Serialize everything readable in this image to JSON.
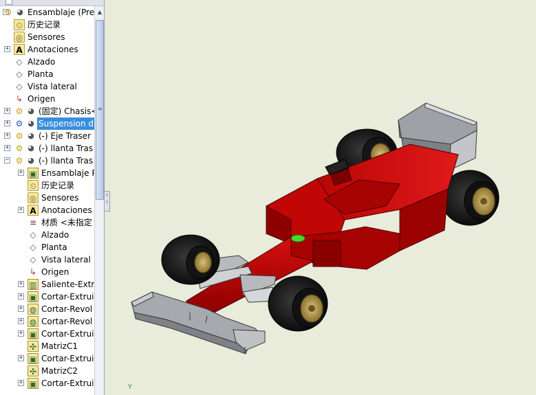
{
  "tree": {
    "rows": [
      {
        "label": "Ensamblaje  (Pre",
        "indent": 0,
        "expander": "−",
        "icon": "assembly-icon",
        "selected": false
      },
      {
        "label": "历史记录",
        "indent": 1,
        "expander": "",
        "icon": "history-icon",
        "selected": false
      },
      {
        "label": "Sensores",
        "indent": 1,
        "expander": "",
        "icon": "sensors-icon",
        "selected": false
      },
      {
        "label": "Anotaciones",
        "indent": 1,
        "expander": "+",
        "icon": "annotations-icon",
        "selected": false
      },
      {
        "label": "Alzado",
        "indent": 1,
        "expander": "",
        "icon": "plane-icon",
        "selected": false
      },
      {
        "label": "Planta",
        "indent": 1,
        "expander": "",
        "icon": "plane-icon",
        "selected": false
      },
      {
        "label": "Vista lateral",
        "indent": 1,
        "expander": "",
        "icon": "plane-icon",
        "selected": false
      },
      {
        "label": "Origen",
        "indent": 1,
        "expander": "",
        "icon": "origin-icon",
        "selected": false
      },
      {
        "label": "(固定) Chasis<",
        "indent": 1,
        "expander": "+",
        "icon": "subassembly-icon",
        "selected": false
      },
      {
        "label": "Suspension d",
        "indent": 1,
        "expander": "+",
        "icon": "subassembly-icon",
        "selected": true
      },
      {
        "label": "(-) Eje Traser",
        "indent": 1,
        "expander": "+",
        "icon": "subassembly-icon",
        "selected": false
      },
      {
        "label": "(-) llanta Tras",
        "indent": 1,
        "expander": "+",
        "icon": "subassembly-icon",
        "selected": false
      },
      {
        "label": "(-) llanta Tras",
        "indent": 1,
        "expander": "−",
        "icon": "subassembly-icon",
        "selected": false
      },
      {
        "label": "Ensamblaje P",
        "indent": 2,
        "expander": "+",
        "icon": "part-doc-icon",
        "selected": false
      },
      {
        "label": "历史记录",
        "indent": 2,
        "expander": "",
        "icon": "history-icon",
        "selected": false
      },
      {
        "label": "Sensores",
        "indent": 2,
        "expander": "",
        "icon": "sensors-icon",
        "selected": false
      },
      {
        "label": "Anotaciones",
        "indent": 2,
        "expander": "+",
        "icon": "annotations-icon",
        "selected": false
      },
      {
        "label": "材质 <未指定",
        "indent": 2,
        "expander": "",
        "icon": "material-icon",
        "selected": false
      },
      {
        "label": "Alzado",
        "indent": 2,
        "expander": "",
        "icon": "plane-icon",
        "selected": false
      },
      {
        "label": "Planta",
        "indent": 2,
        "expander": "",
        "icon": "plane-icon",
        "selected": false
      },
      {
        "label": "Vista lateral",
        "indent": 2,
        "expander": "",
        "icon": "plane-icon",
        "selected": false
      },
      {
        "label": "Origen",
        "indent": 2,
        "expander": "",
        "icon": "origin-icon",
        "selected": false
      },
      {
        "label": "Saliente-Extru",
        "indent": 2,
        "expander": "+",
        "icon": "extrude-icon",
        "selected": false
      },
      {
        "label": "Cortar-Extrui",
        "indent": 2,
        "expander": "+",
        "icon": "cut-extrude-icon",
        "selected": false
      },
      {
        "label": "Cortar-Revol",
        "indent": 2,
        "expander": "+",
        "icon": "cut-revolve-icon",
        "selected": false
      },
      {
        "label": "Cortar-Revol",
        "indent": 2,
        "expander": "+",
        "icon": "cut-revolve-icon",
        "selected": false
      },
      {
        "label": "Cortar-Extrui",
        "indent": 2,
        "expander": "+",
        "icon": "cut-extrude-icon",
        "selected": false
      },
      {
        "label": "MatrizC1",
        "indent": 2,
        "expander": "",
        "icon": "circular-pattern-icon",
        "selected": false
      },
      {
        "label": "Cortar-Extrui",
        "indent": 2,
        "expander": "+",
        "icon": "cut-extrude-icon",
        "selected": false
      },
      {
        "label": "MatrizC2",
        "indent": 2,
        "expander": "",
        "icon": "circular-pattern-icon",
        "selected": false
      },
      {
        "label": "Cortar-Extrui",
        "indent": 2,
        "expander": "+",
        "icon": "cut-extrude-icon",
        "selected": false
      }
    ]
  },
  "viewport": {
    "axis_label": "Y"
  },
  "colors": {
    "background": "#e9ebdb",
    "car_body": "#b50000",
    "selection": "#3a8fdc",
    "tire": "#151515",
    "rim": "#b9a055",
    "wing": "#8e9196"
  }
}
